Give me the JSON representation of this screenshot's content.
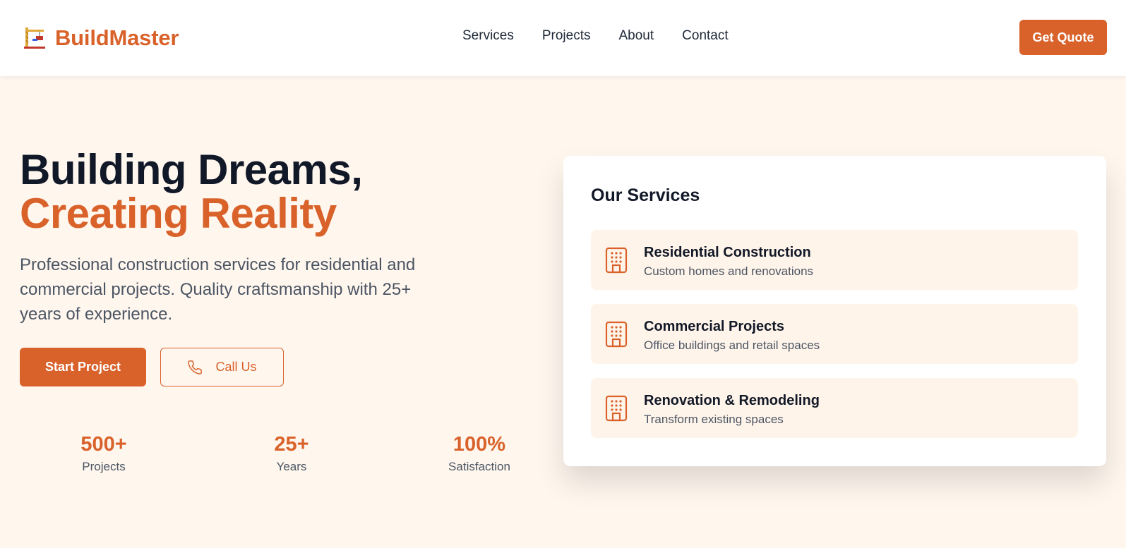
{
  "header": {
    "brand": "BuildMaster",
    "nav": [
      "Services",
      "Projects",
      "About",
      "Contact"
    ],
    "cta": "Get Quote"
  },
  "hero": {
    "title_line1": "Building Dreams,",
    "title_line2": "Creating Reality",
    "description": "Professional construction services for residential and commercial projects. Quality craftsmanship with 25+ years of experience.",
    "primary_button": "Start Project",
    "secondary_button": "Call Us",
    "stats": [
      {
        "value": "500+",
        "label": "Projects"
      },
      {
        "value": "25+",
        "label": "Years"
      },
      {
        "value": "100%",
        "label": "Satisfaction"
      }
    ]
  },
  "services_card": {
    "title": "Our Services",
    "items": [
      {
        "name": "Residential Construction",
        "description": "Custom homes and renovations",
        "icon": "building-icon"
      },
      {
        "name": "Commercial Projects",
        "description": "Office buildings and retail spaces",
        "icon": "building-icon"
      },
      {
        "name": "Renovation & Remodeling",
        "description": "Transform existing spaces",
        "icon": "building-icon"
      }
    ]
  },
  "colors": {
    "accent": "#d9622b",
    "background": "#fff6ee",
    "service_bg": "#fff4ea",
    "text_dark": "#111827",
    "text_muted": "#4b5563"
  },
  "icons": {
    "brand": "construction-crane-icon",
    "call": "phone-icon"
  }
}
